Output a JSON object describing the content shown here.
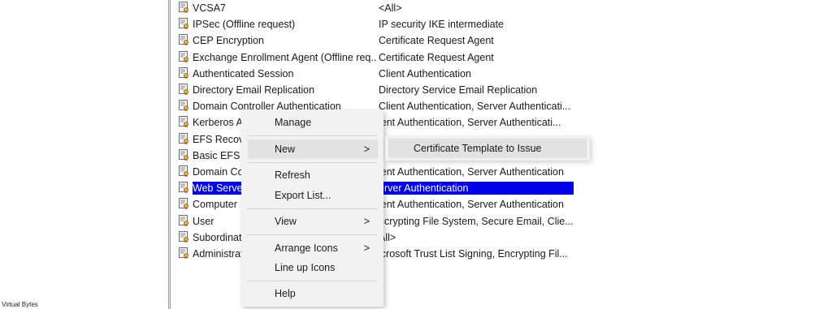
{
  "footer_label": "Virtual Bytes",
  "templates": [
    {
      "name": "VCSA7",
      "purpose": "<All>"
    },
    {
      "name": "IPSec (Offline request)",
      "purpose": "IP security IKE intermediate"
    },
    {
      "name": "CEP Encryption",
      "purpose": "Certificate Request Agent"
    },
    {
      "name": "Exchange Enrollment Agent (Offline req...",
      "purpose": "Certificate Request Agent"
    },
    {
      "name": "Authenticated Session",
      "purpose": "Client Authentication"
    },
    {
      "name": "Directory Email Replication",
      "purpose": "Directory Service Email Replication"
    },
    {
      "name": "Domain Controller Authentication",
      "purpose": "Client Authentication, Server Authenticati..."
    },
    {
      "name": "Kerberos A",
      "purpose": "ient Authentication, Server Authenticati..."
    },
    {
      "name": "EFS Recove",
      "purpose": ""
    },
    {
      "name": "Basic EFS",
      "purpose": ""
    },
    {
      "name": "Domain Co",
      "purpose": "ient Authentication, Server Authentication"
    },
    {
      "name": "Web Server",
      "purpose": "erver Authentication"
    },
    {
      "name": "Computer",
      "purpose": "ient Authentication, Server Authentication"
    },
    {
      "name": "User",
      "purpose": "ncrypting File System, Secure Email, Clie..."
    },
    {
      "name": "Subordinat",
      "purpose": "All>"
    },
    {
      "name": "Administrat",
      "purpose": "icrosoft Trust List Signing, Encrypting Fil..."
    }
  ],
  "context_menu": {
    "manage": "Manage",
    "new": "New",
    "refresh": "Refresh",
    "export_list": "Export List...",
    "view": "View",
    "arrange_icons": "Arrange Icons",
    "line_up_icons": "Line up Icons",
    "help": "Help",
    "arrow": ">"
  },
  "submenu": {
    "certificate_template_to_issue": "Certificate Template to Issue"
  },
  "colors": {
    "selection": "#0000e6",
    "menu_bg": "#f2f2f2",
    "menu_highlight": "#e2e2e2"
  }
}
